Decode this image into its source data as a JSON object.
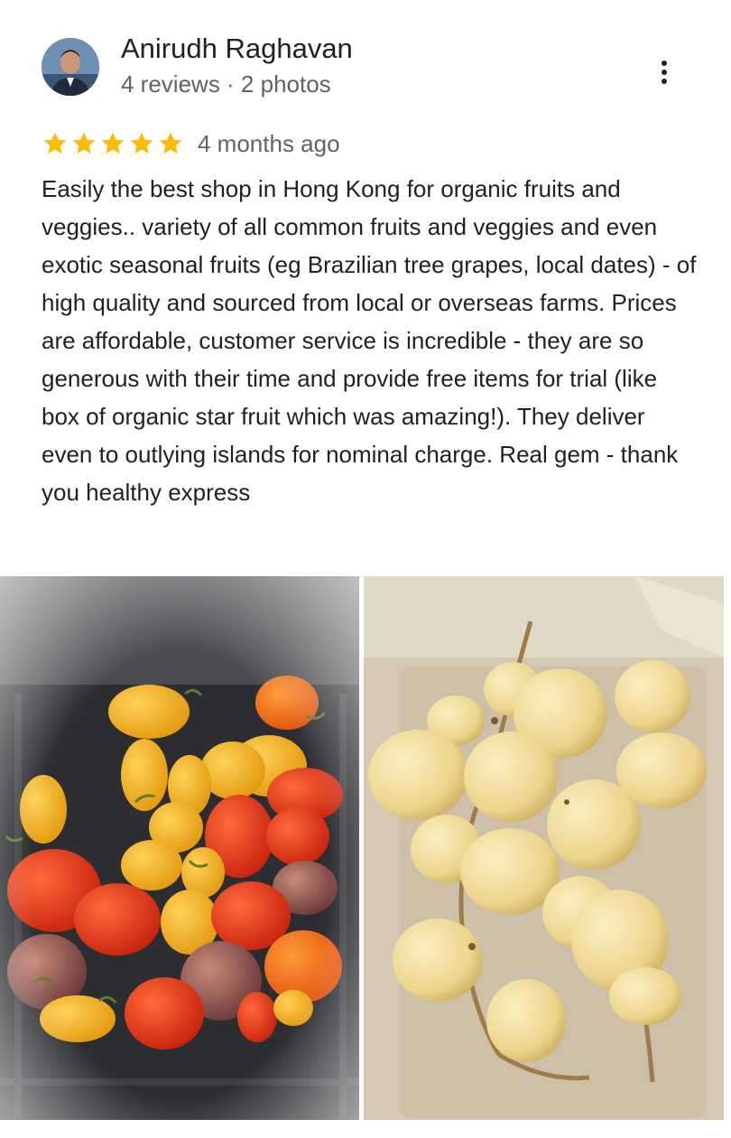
{
  "reviewer": {
    "name": "Anirudh Raghavan",
    "stats": "4 reviews · 2 photos",
    "avatar_icon": "person-avatar"
  },
  "menu": {
    "icon": "more-vert-icon"
  },
  "rating": {
    "stars": 5,
    "max": 5,
    "star_color": "#fbbc04"
  },
  "time_ago": "4 months ago",
  "review_text": "Easily the best shop in Hong Kong for organic fruits and veggies.. variety of all common fruits and veggies and even exotic seasonal fruits (eg Brazilian tree grapes, local dates) - of high quality and sourced from local or overseas farms. Prices are affordable, customer service is incredible - they are so generous with their time and provide free items for trial (like box of organic star fruit which was amazing!). They deliver even to outlying islands for nominal charge. Real gem - thank you healthy express",
  "photos": [
    {
      "subject": "mixed cherry tomatoes in a dark crate"
    },
    {
      "subject": "fresh dates on a stem in a cardboard box"
    }
  ]
}
